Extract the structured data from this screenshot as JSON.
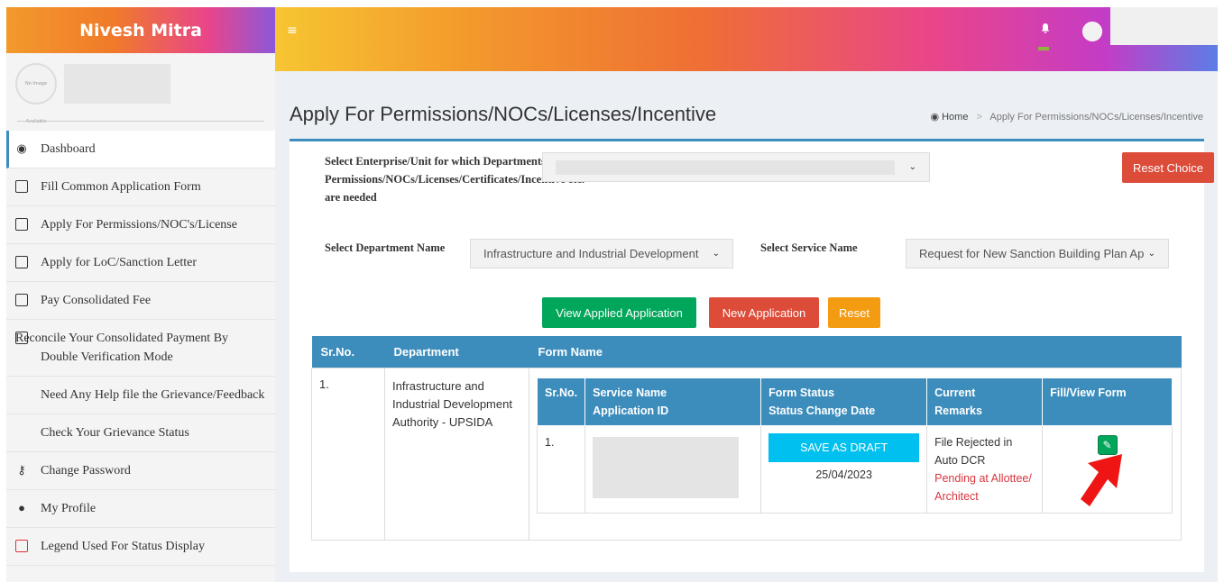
{
  "sidebar": {
    "brand": "Nivesh Mitra",
    "avatar_text": "No Image Available",
    "items": [
      {
        "label": "Dashboard",
        "icon": "dashboard-icon"
      },
      {
        "label": "Fill Common Application Form",
        "icon": "form-icon"
      },
      {
        "label": "Apply For Permissions/NOC's/License",
        "icon": "document-icon"
      },
      {
        "label": "Apply for LoC/Sanction Letter",
        "icon": "document-icon"
      },
      {
        "label": "Pay Consolidated Fee",
        "icon": "credit-card-icon"
      },
      {
        "label": "Reconcile Your Consolidated Payment By Double Verification Mode",
        "icon": "credit-card-icon"
      },
      {
        "label": "Need Any Help file the Grievance/Feedback",
        "icon": ""
      },
      {
        "label": "Check Your Grievance Status",
        "icon": ""
      },
      {
        "label": "Change Password",
        "icon": "key-icon"
      },
      {
        "label": "My Profile",
        "icon": "user-icon"
      },
      {
        "label": "Legend Used For Status Display",
        "icon": "square-icon"
      }
    ]
  },
  "header": {
    "menu_icon": "≡",
    "colors": {
      "accent": "#3c8dbc"
    }
  },
  "page": {
    "title": "Apply For Permissions/NOCs/Licenses/Incentive",
    "breadcrumb_home": "Home",
    "breadcrumb_current": "Apply For Permissions/NOCs/Licenses/Incentive"
  },
  "form": {
    "enterprise_label": "Select Enterprise/Unit for which Departments Permissions/NOCs/Licenses/Certificates/Incentive etc. are needed",
    "department_label": "Select Department Name",
    "department_value": "Infrastructure and Industrial Development",
    "service_label": "Select Service Name",
    "service_value": "Request for New Sanction Building Plan Ap",
    "reset_choice": "Reset Choice",
    "view_applied": "View Applied Application",
    "new_application": "New Application",
    "reset": "Reset"
  },
  "outer_table": {
    "headers": [
      "Sr.No.",
      "Department",
      "Form Name"
    ],
    "row": {
      "srno": "1.",
      "department": "Infrastructure and Industrial Development Authority - UPSIDA"
    }
  },
  "inner_table": {
    "headers": {
      "srno": "Sr.No.",
      "service_name": "Service Name",
      "application_id": "Application ID",
      "form_status": "Form Status",
      "status_change_date": "Status Change Date",
      "current": "Current",
      "remarks": "Remarks",
      "fill_view": "Fill/View Form"
    },
    "row": {
      "srno": "1.",
      "status_button": "SAVE AS DRAFT",
      "date": "25/04/2023",
      "remark": "File Rejected in Auto DCR",
      "pending": "Pending at Allottee/ Architect"
    }
  }
}
